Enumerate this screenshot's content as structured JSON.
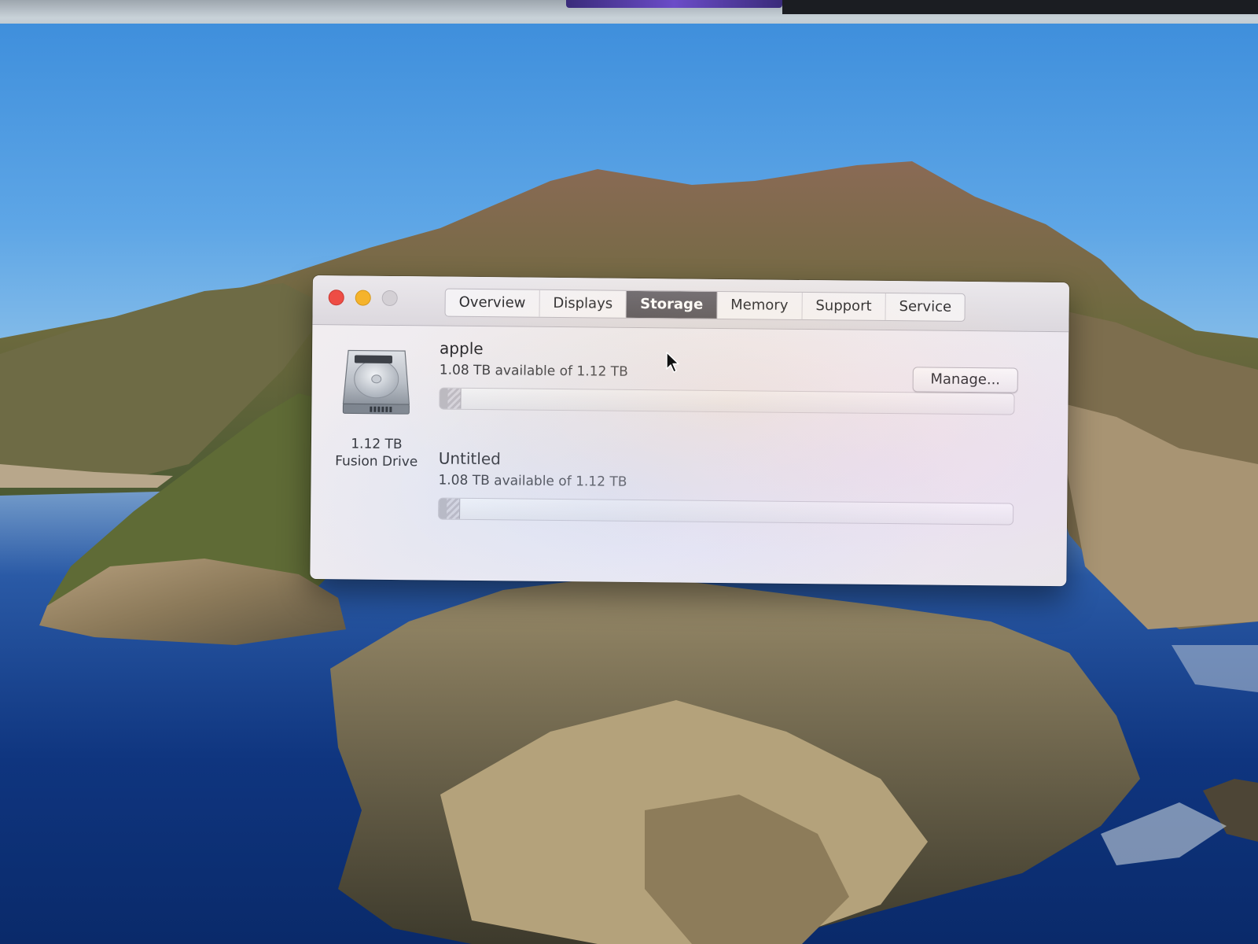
{
  "window": {
    "tabs": [
      {
        "label": "Overview",
        "active": false
      },
      {
        "label": "Displays",
        "active": false
      },
      {
        "label": "Storage",
        "active": true
      },
      {
        "label": "Memory",
        "active": false
      },
      {
        "label": "Support",
        "active": false
      },
      {
        "label": "Service",
        "active": false
      }
    ]
  },
  "storage": {
    "disk": {
      "icon": "hard-drive-icon",
      "size": "1.12 TB",
      "name": "Fusion Drive"
    },
    "manage_label": "Manage...",
    "volumes": [
      {
        "name": "apple",
        "availability": "1.08 TB available of 1.12 TB",
        "used_fraction": 0.036
      },
      {
        "name": "Untitled",
        "availability": "1.08 TB available of 1.12 TB",
        "used_fraction": 0.036
      }
    ]
  },
  "colors": {
    "close": "#ee4d45",
    "minimize": "#f5b32b",
    "zoom_disabled": "#d4d0d5",
    "active_tab": "#5f5c63"
  }
}
